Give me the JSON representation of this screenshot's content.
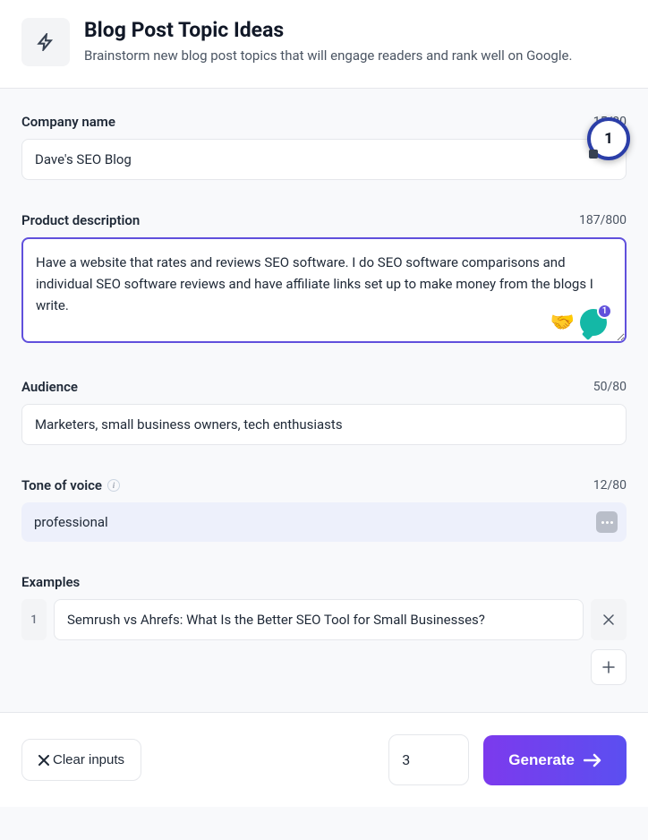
{
  "header": {
    "title": "Blog Post Topic Ideas",
    "subtitle": "Brainstorm new blog post topics that will engage readers and rank well on Google."
  },
  "company": {
    "label": "Company name",
    "value": "Dave's SEO Blog",
    "count": "15/80"
  },
  "description": {
    "label": "Product description",
    "value": "Have a website that rates and reviews SEO software. I do SEO software comparisons and individual SEO software reviews and have affiliate links set up to make money from the blogs I write.",
    "count": "187/800"
  },
  "audience": {
    "label": "Audience",
    "value": "Marketers, small business owners, tech enthusiasts",
    "count": "50/80"
  },
  "tone": {
    "label": "Tone of voice",
    "value": "professional",
    "count": "12/80"
  },
  "examples": {
    "label": "Examples",
    "items": [
      {
        "num": "1",
        "value": "Semrush vs Ahrefs: What Is the Better SEO Tool for Small Businesses?"
      }
    ]
  },
  "footer": {
    "clear": "Clear inputs",
    "count": "3",
    "generate": "Generate"
  },
  "badge": {
    "step": "1",
    "chat_count": "1"
  }
}
